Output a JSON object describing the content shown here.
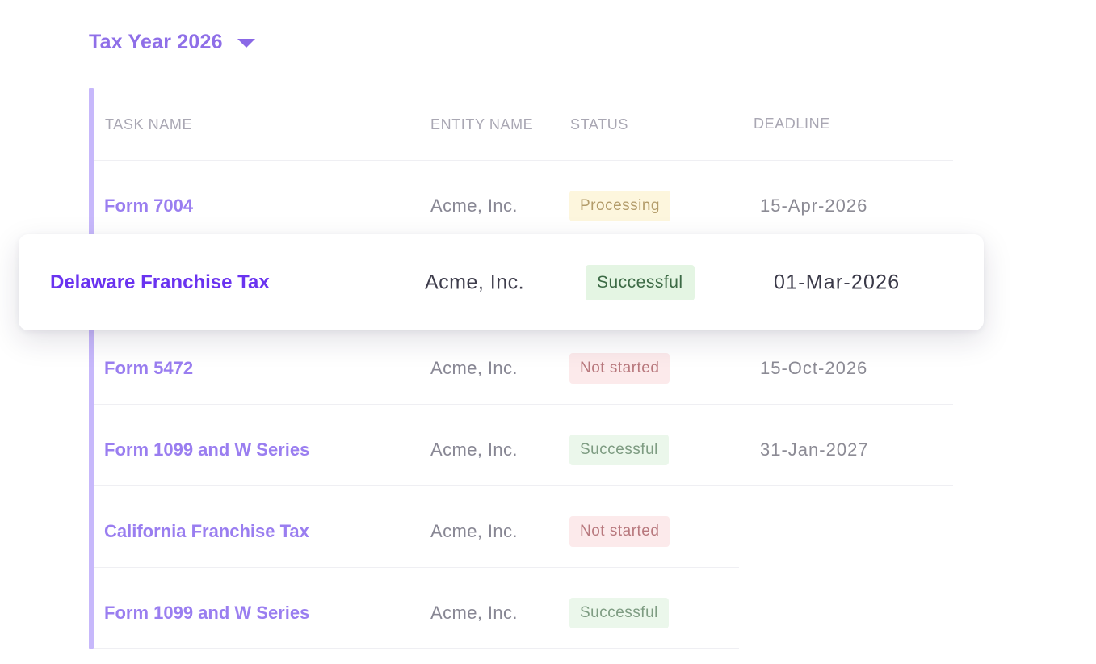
{
  "year_selector": {
    "label": "Tax Year 2026"
  },
  "table": {
    "headers": {
      "task": "TASK NAME",
      "entity": "ENTITY NAME",
      "status": "STATUS",
      "deadline": "DEADLINE"
    },
    "rows": [
      {
        "task": "Form 7004",
        "entity": "Acme, Inc.",
        "status": "Processing",
        "deadline": "15-Apr-2026"
      },
      {
        "task": "Form 5472",
        "entity": "Acme, Inc.",
        "status": "Not started",
        "deadline": "15-Oct-2026"
      },
      {
        "task": "Form 1099 and W Series",
        "entity": "Acme, Inc.",
        "status": "Successful",
        "deadline": "31-Jan-2027"
      },
      {
        "task": "California Franchise Tax",
        "entity": "Acme, Inc.",
        "status": "Not started",
        "deadline": ""
      },
      {
        "task": "Form 1099 and W Series",
        "entity": "Acme, Inc.",
        "status": "Successful",
        "deadline": ""
      }
    ],
    "highlighted": {
      "task": "Delaware Franchise Tax",
      "entity": "Acme, Inc.",
      "status": "Successful",
      "deadline": "01-Mar-2026"
    }
  },
  "colors": {
    "accent": "#8f6fe8",
    "accent_strong": "#6a33f0",
    "accent_bar": "#c7b8fb",
    "status_processing_bg": "#fdf6dd",
    "status_successful_bg": "#ebf7eb",
    "status_not_started_bg": "#fceaeb"
  }
}
